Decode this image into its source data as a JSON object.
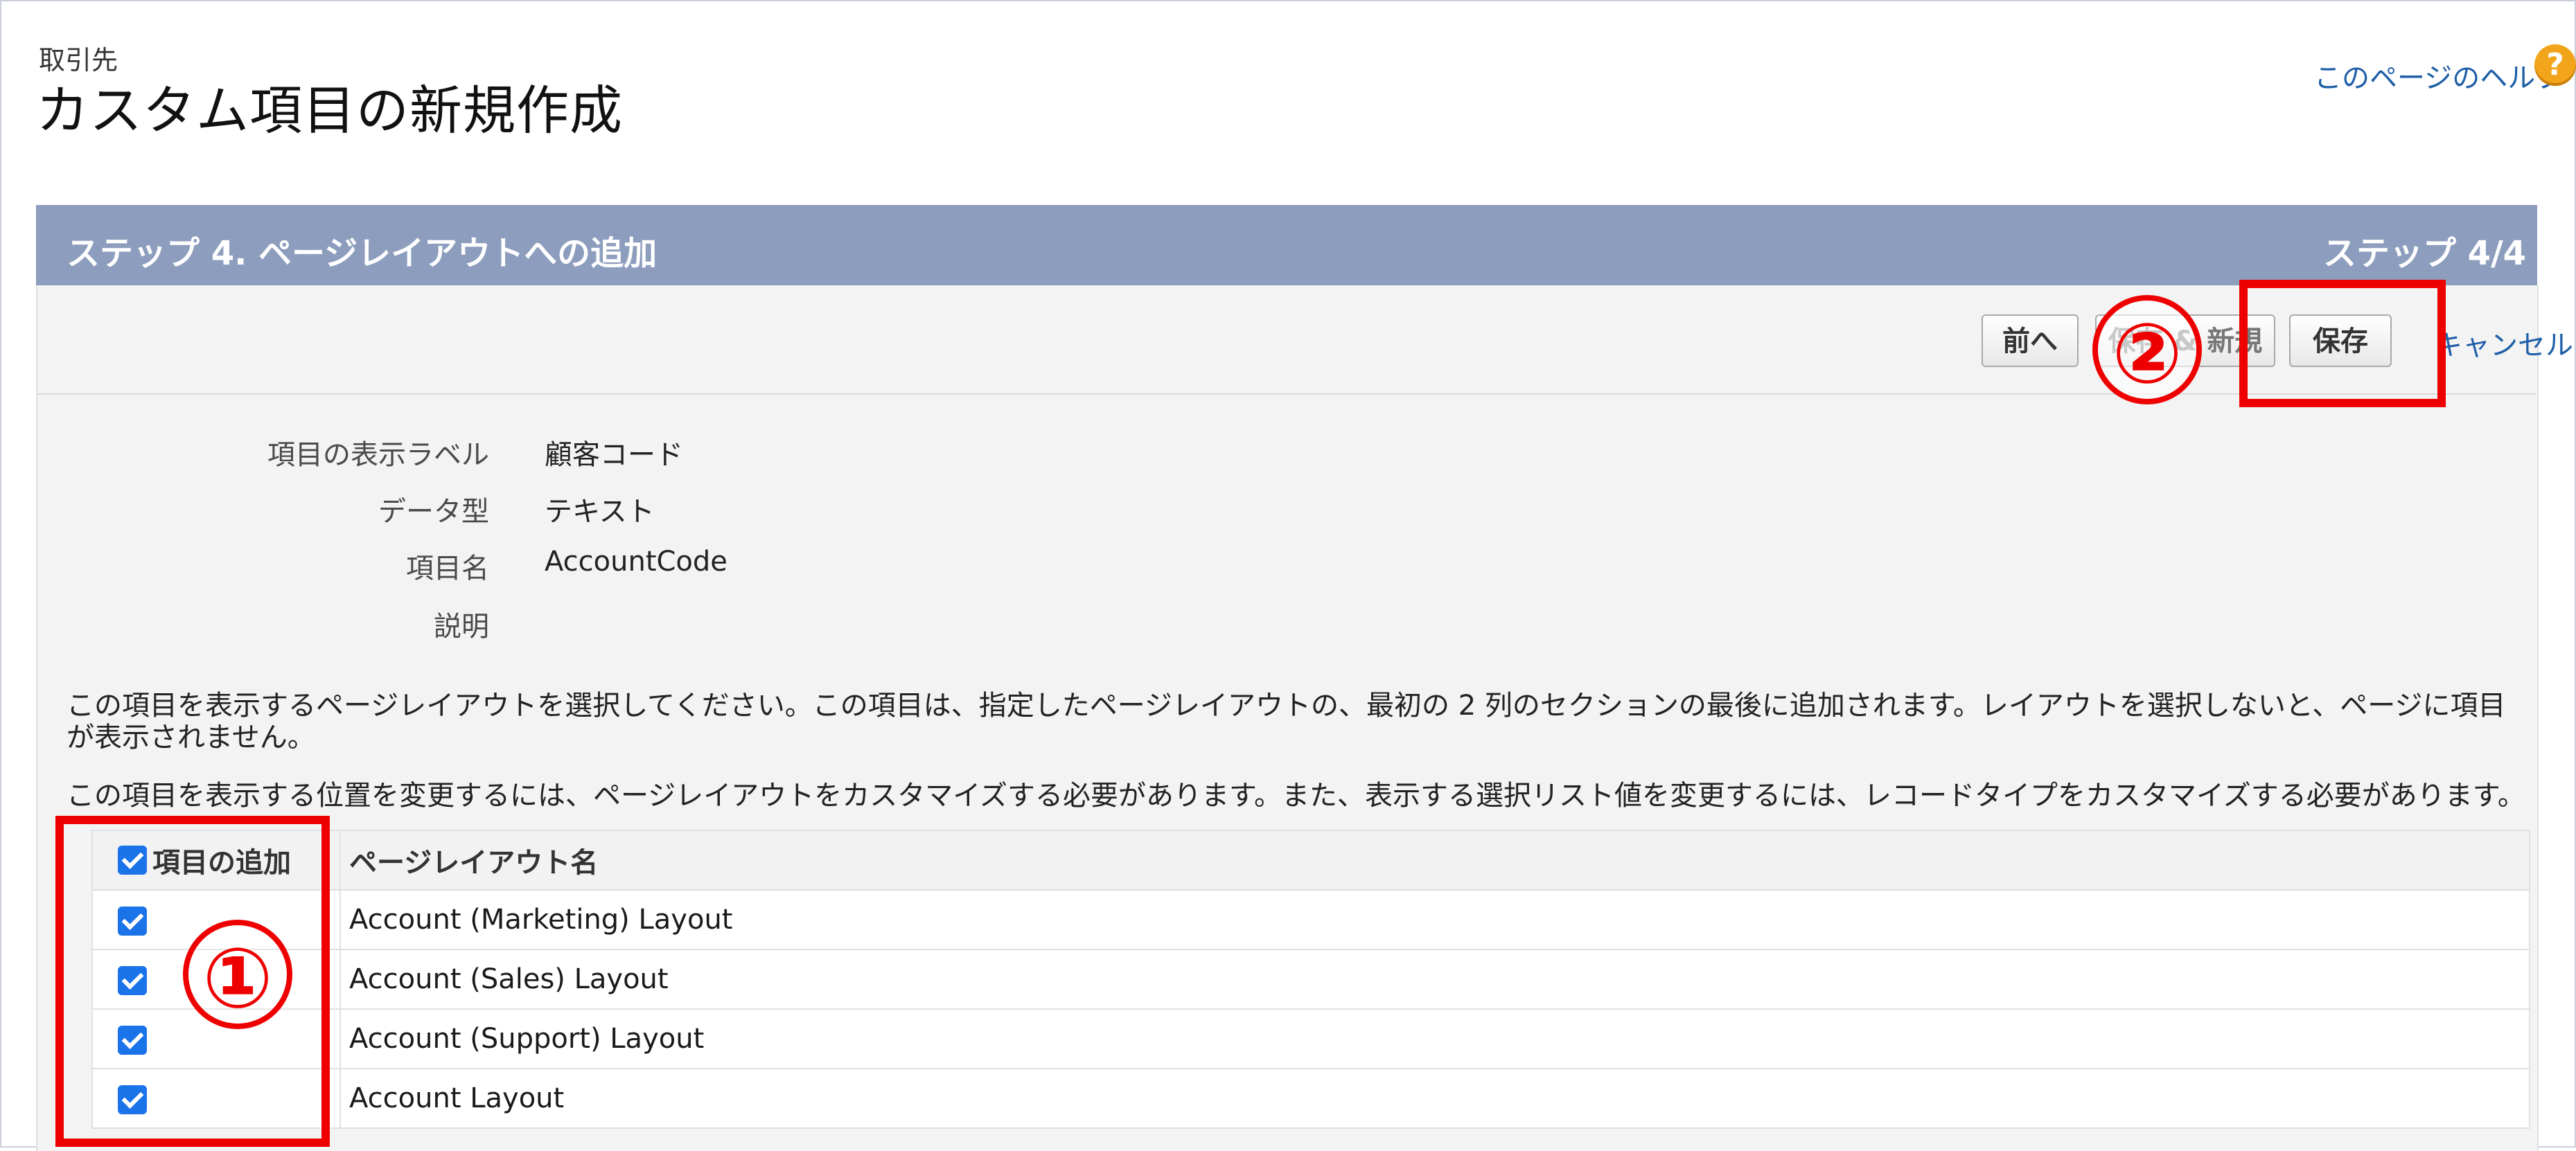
{
  "header": {
    "object_label": "取引先",
    "title": "カスタム項目の新規作成",
    "help_link": "このページのヘルプ",
    "help_icon": "?"
  },
  "step": {
    "title": "ステップ 4. ページレイアウトへの追加",
    "count": "ステップ 4/4"
  },
  "toolbar": {
    "prev_label": "前へ",
    "save_new_label": "保存 & 新規",
    "save_label": "保存",
    "cancel_label": "キャンセル"
  },
  "fields": [
    {
      "label": "項目の表示ラベル",
      "value": "顧客コード"
    },
    {
      "label": "データ型",
      "value": "テキスト"
    },
    {
      "label": "項目名",
      "value": "AccountCode"
    },
    {
      "label": "説明",
      "value": ""
    }
  ],
  "instructions": {
    "para1": "この項目を表示するページレイアウトを選択してください。この項目は、指定したページレイアウトの、最初の 2 列のセクションの最後に追加されます。レイアウトを選択しないと、ページに項目が表示されません。",
    "para2": "この項目を表示する位置を変更するには、ページレイアウトをカスタマイズする必要があります。また、表示する選択リスト値を変更するには、レコードタイプをカスタマイズする必要があります。"
  },
  "layout_table": {
    "col_add": "項目の追加",
    "col_name": "ページレイアウト名",
    "rows": [
      {
        "checked": true,
        "name": "Account (Marketing) Layout"
      },
      {
        "checked": true,
        "name": "Account (Sales) Layout"
      },
      {
        "checked": true,
        "name": "Account (Support) Layout"
      },
      {
        "checked": true,
        "name": "Account Layout"
      }
    ]
  },
  "annotations": {
    "marker_1": "①",
    "marker_2": "②",
    "color": "#ee0000"
  },
  "colors": {
    "step_bar": "#8d9dbd",
    "link": "#1f5fa8",
    "checkbox": "#1a73e8",
    "help_icon": "#f2a51a"
  }
}
